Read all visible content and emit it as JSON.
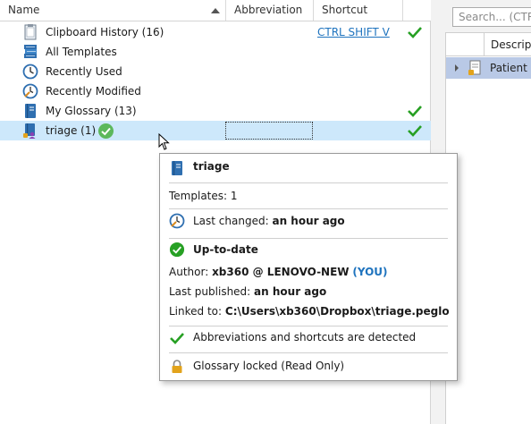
{
  "columns": {
    "name": "Name",
    "abbreviation": "Abbreviation",
    "shortcut": "Shortcut"
  },
  "tree": [
    {
      "label": "Clipboard History (16)",
      "icon": "clipboard-icon",
      "shortcut": "CTRL SHIFT V",
      "checked": true
    },
    {
      "label": "All Templates",
      "icon": "books-icon",
      "shortcut": "",
      "checked": false
    },
    {
      "label": "Recently Used",
      "icon": "clock-icon",
      "shortcut": "",
      "checked": false
    },
    {
      "label": "Recently Modified",
      "icon": "modified-clock-icon",
      "shortcut": "",
      "checked": false
    },
    {
      "label": "My Glossary (13)",
      "icon": "glossary-book-icon",
      "shortcut": "",
      "checked": true
    },
    {
      "label": "triage (1)",
      "icon": "shared-glossary-icon",
      "shortcut": "",
      "checked": true,
      "selected": true
    }
  ],
  "search": {
    "placeholder": "Search... (CTRL"
  },
  "grid": {
    "header": "Descript",
    "row": "Patient c"
  },
  "tooltip": {
    "title": "triage",
    "templates": "Templates: 1",
    "last_changed_label": "Last changed:",
    "last_changed_value": "an hour ago",
    "status": "Up-to-date",
    "author_label": "Author:",
    "author_value": "xb360 @ LENOVO-NEW",
    "author_you": "(YOU)",
    "last_published_label": "Last published:",
    "last_published_value": "an hour ago",
    "linked_label": "Linked to:",
    "linked_value": "C:\\Users\\xb360\\Dropbox\\triage.peglo",
    "detected": "Abbreviations and shortcuts are detected",
    "locked": "Glossary locked (Read Only)"
  },
  "colors": {
    "selection": "#cde8fb",
    "check_green": "#27a024",
    "link_blue": "#1e73be"
  }
}
